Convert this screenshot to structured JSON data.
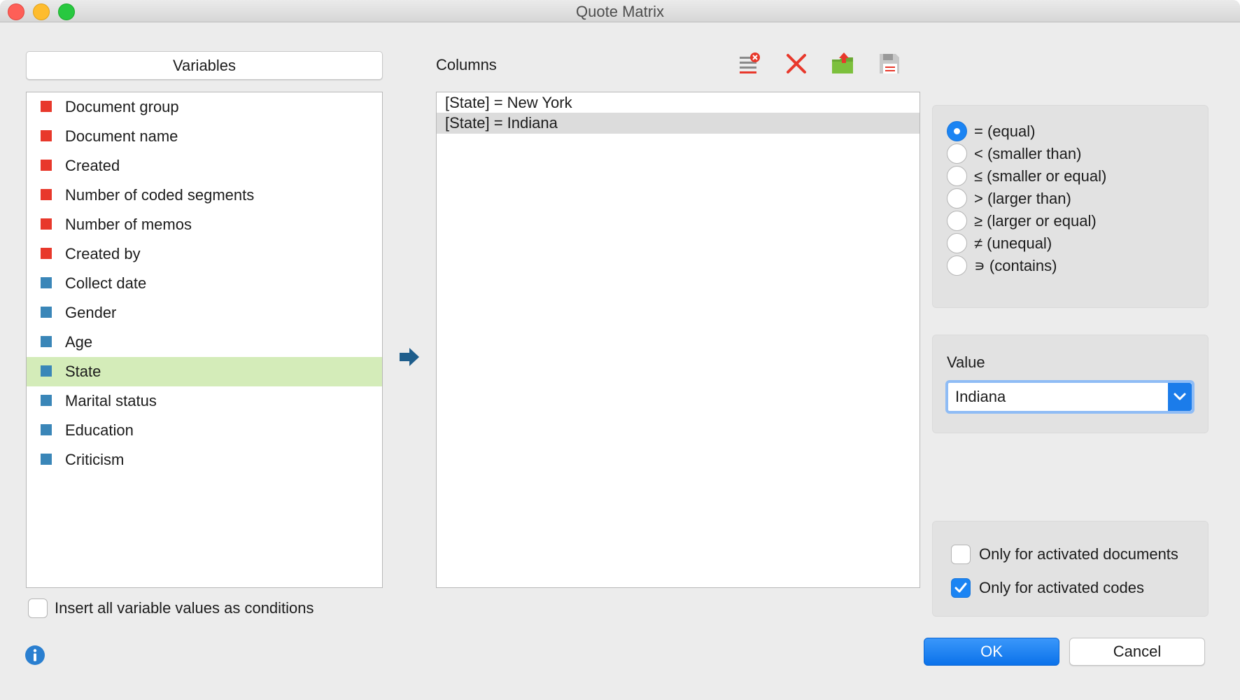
{
  "window": {
    "title": "Quote Matrix"
  },
  "variables": {
    "header": "Variables",
    "items": [
      {
        "label": "Document group",
        "color": "#e8382b"
      },
      {
        "label": "Document name",
        "color": "#e8382b"
      },
      {
        "label": "Created",
        "color": "#e8382b"
      },
      {
        "label": "Number of coded segments",
        "color": "#e8382b"
      },
      {
        "label": "Number of memos",
        "color": "#e8382b"
      },
      {
        "label": "Created by",
        "color": "#e8382b"
      },
      {
        "label": "Collect date",
        "color": "#3a86b8"
      },
      {
        "label": "Gender",
        "color": "#3a86b8"
      },
      {
        "label": "Age",
        "color": "#3a86b8"
      },
      {
        "label": "State",
        "color": "#3a86b8",
        "selected": true
      },
      {
        "label": "Marital status",
        "color": "#3a86b8"
      },
      {
        "label": "Education",
        "color": "#3a86b8"
      },
      {
        "label": "Criticism",
        "color": "#3a86b8"
      }
    ],
    "insert_all_label": "Insert all variable values as conditions",
    "insert_all_checked": false
  },
  "columns": {
    "label": "Columns",
    "toolbar": [
      "clear-list-icon",
      "delete-icon",
      "open-folder-icon",
      "save-icon"
    ],
    "items": [
      {
        "label": "[State] = New York",
        "selected": false
      },
      {
        "label": "[State] = Indiana",
        "selected": true
      }
    ]
  },
  "operators": {
    "options": [
      {
        "label": "= (equal)",
        "selected": true
      },
      {
        "label": "< (smaller than)",
        "selected": false
      },
      {
        "label": "≤ (smaller or equal)",
        "selected": false
      },
      {
        "label": "> (larger than)",
        "selected": false
      },
      {
        "label": "≥ (larger or equal)",
        "selected": false
      },
      {
        "label": "≠ (unequal)",
        "selected": false
      },
      {
        "label": "∍ (contains)",
        "selected": false
      }
    ]
  },
  "value": {
    "label": "Value",
    "selected": "Indiana"
  },
  "options": {
    "activated_documents": {
      "label": "Only for activated documents",
      "checked": false
    },
    "activated_codes": {
      "label": "Only for activated codes",
      "checked": true
    }
  },
  "buttons": {
    "ok": "OK",
    "cancel": "Cancel"
  },
  "colors": {
    "accent": "#1b84f3",
    "selected_row": "#d4ecb9"
  }
}
